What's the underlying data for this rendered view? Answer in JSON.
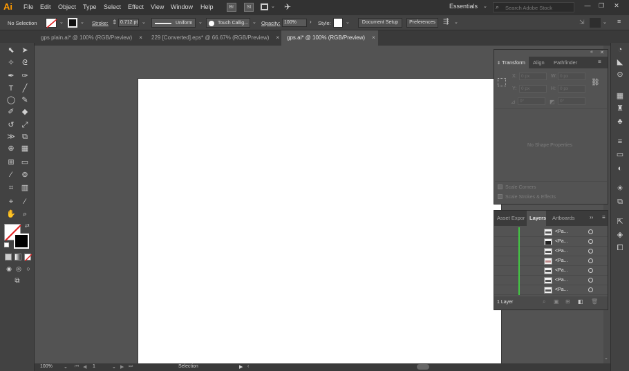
{
  "menubar": {
    "logo": "Ai",
    "items": [
      "File",
      "Edit",
      "Object",
      "Type",
      "Select",
      "Effect",
      "View",
      "Window",
      "Help"
    ],
    "br_icon": "Br",
    "st_icon": "St",
    "workspace": "Essentials",
    "search_placeholder": "Search Adobe Stock"
  },
  "controlbar": {
    "selection_label": "No Selection",
    "stroke_label": "Stroke:",
    "stroke_value": "0.712 pt",
    "profile_label": "Uniform",
    "brush_label": "Touch Callig...",
    "opacity_label": "Opacity:",
    "opacity_value": "100%",
    "style_label": "Style:",
    "document_setup": "Document Setup",
    "preferences": "Preferences"
  },
  "tabs": [
    {
      "label": "gps plain.ai* @ 100% (RGB/Preview)",
      "close": "×"
    },
    {
      "label": "229 [Converted].eps* @ 66.67% (RGB/Preview)",
      "close": "×"
    },
    {
      "label": "gps.ai* @ 100% (RGB/Preview)",
      "close": "×"
    }
  ],
  "transform_panel": {
    "tabs": [
      "Transform",
      "Align",
      "Pathfinder"
    ],
    "x_label": "X:",
    "x_value": "0 px",
    "y_label": "Y:",
    "y_value": "0 px",
    "w_label": "W:",
    "w_value": "0 px",
    "h_label": "H:",
    "h_value": "0 px",
    "angle_value": "0°",
    "shear_value": "0°",
    "no_shape": "No Shape Properties",
    "scale_corners": "Scale Corners",
    "scale_strokes": "Scale Strokes & Effects"
  },
  "layers_panel": {
    "tabs": [
      "Asset Expor",
      "Layers",
      "Artboards"
    ],
    "rows": [
      "<Pa...",
      "<Pa...",
      "<Pa...",
      "<Pa...",
      "<Pa...",
      "<Pa...",
      "<Pa..."
    ],
    "layer_count": "1 Layer"
  },
  "statusbar": {
    "zoom": "100%",
    "page": "1",
    "tool": "Selection"
  },
  "colors": {
    "app_bg": "#535353",
    "panel_dark": "#323232",
    "layer_green": "#43c843",
    "logo_orange": "#ff9a00"
  }
}
